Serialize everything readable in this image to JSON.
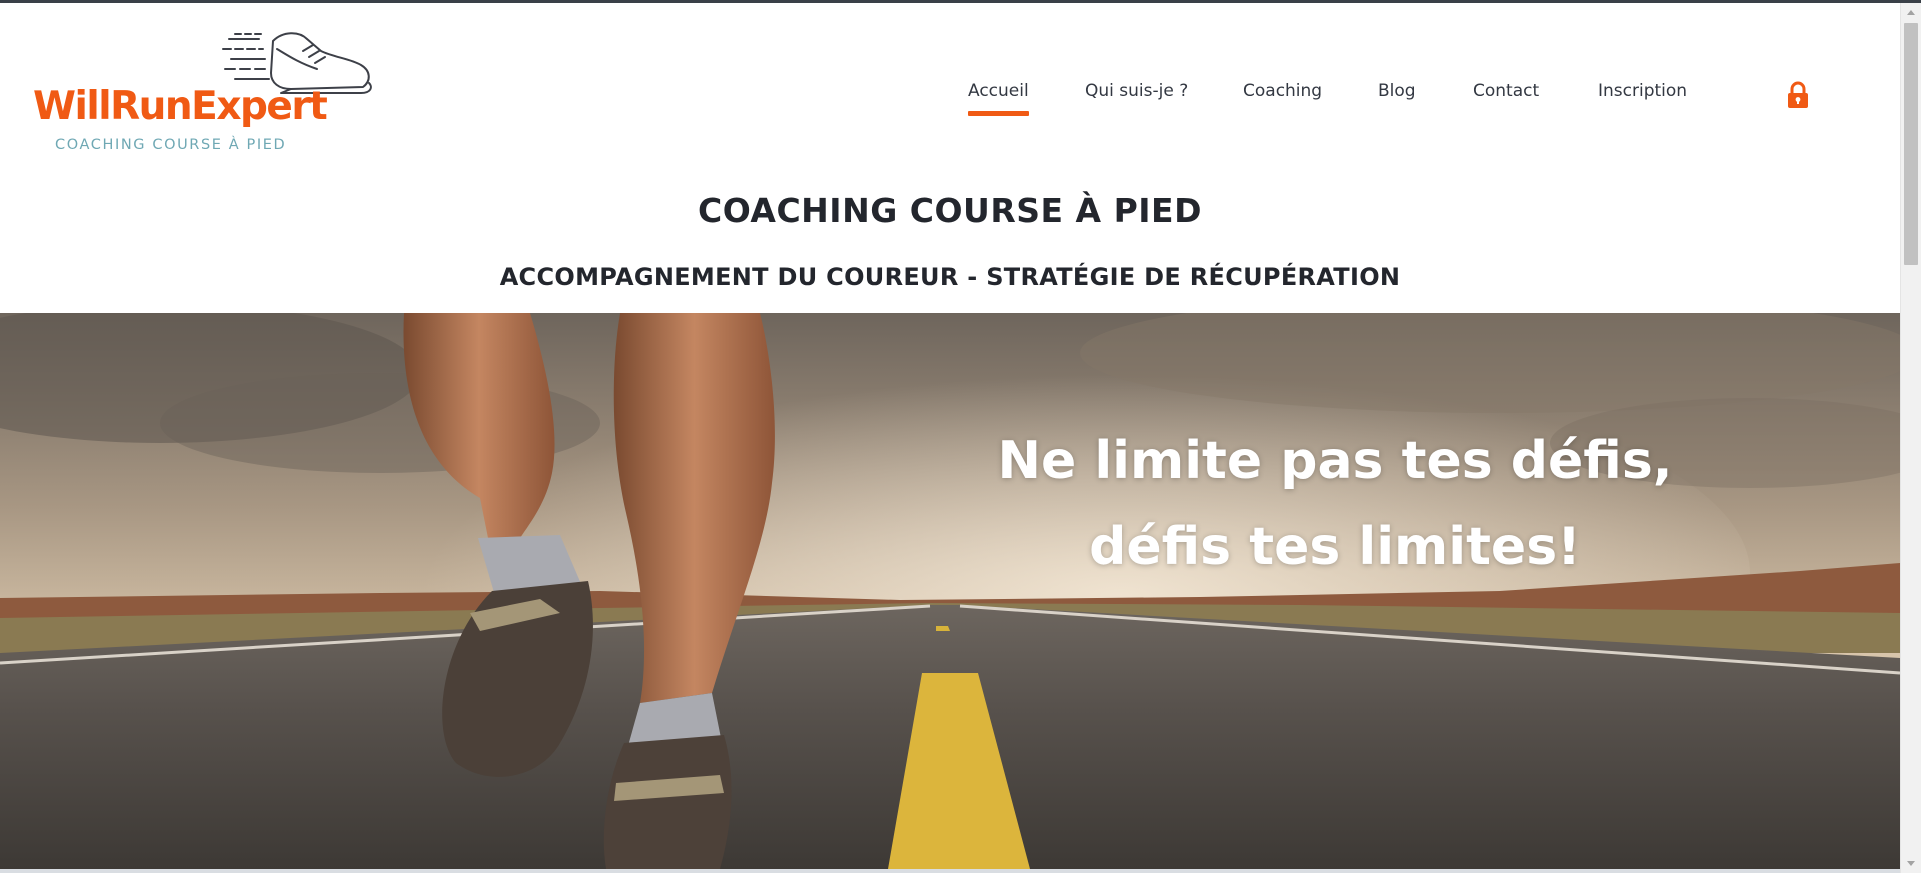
{
  "brand": {
    "name": "WillRunExpert",
    "tagline": "COACHING COURSE À PIED",
    "accent_color": "#f05a14",
    "tagline_color": "#6fa8b4",
    "logo_icon": "running-shoe-icon"
  },
  "nav": {
    "items": [
      {
        "label": "Accueil",
        "active": true
      },
      {
        "label": "Qui suis-je ?",
        "active": false
      },
      {
        "label": "Coaching",
        "active": false
      },
      {
        "label": "Blog",
        "active": false
      },
      {
        "label": "Contact",
        "active": false
      },
      {
        "label": "Inscription",
        "active": false
      }
    ],
    "account_icon": "lock-icon"
  },
  "header": {
    "title": "COACHING COURSE À PIED",
    "subtitle": "ACCOMPAGNEMENT DU COUREUR - STRATÉGIE DE RÉCUPÉRATION"
  },
  "hero": {
    "line1": "Ne limite pas tes défis,",
    "line2": "défis tes limites!"
  }
}
